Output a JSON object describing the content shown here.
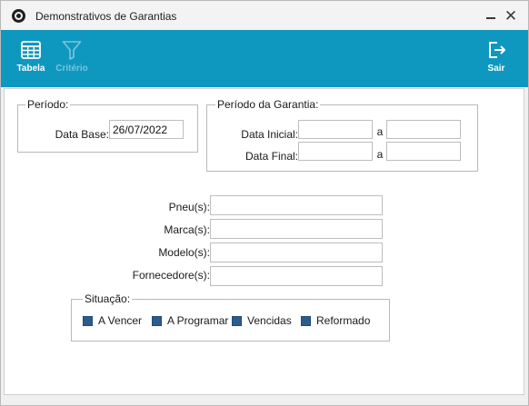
{
  "window": {
    "title": "Demonstrativos de Garantias",
    "icons": {
      "app": "app-logo-icon",
      "minimize": "minimize-icon",
      "close": "close-icon"
    },
    "close_glyph": "✕"
  },
  "toolbar": {
    "bg_color": "#0f98bf",
    "tabela": {
      "label": "Tabela",
      "icon": "table-grid-icon"
    },
    "criterio": {
      "label": "Critério",
      "icon": "filter-funnel-icon",
      "disabled": true
    },
    "sair": {
      "label": "Sair",
      "icon": "exit-door-icon"
    }
  },
  "periodo": {
    "legend": "Período:",
    "data_base_label": "Data Base:",
    "data_base_value": "26/07/2022"
  },
  "periodo_garantia": {
    "legend": "Período da Garantia:",
    "data_inicial_label": "Data Inicial:",
    "data_final_label": "Data Final:",
    "separator": "a",
    "data_inicial_value": "",
    "data_inicial_ate_value": "",
    "data_final_value": "",
    "data_final_ate_value": ""
  },
  "filters": {
    "pneus_label": "Pneu(s):",
    "marcas_label": "Marca(s):",
    "modelos_label": "Modelo(s):",
    "fornecedores_label": "Fornecedore(s):"
  },
  "situacao": {
    "legend": "Situação:",
    "options": [
      {
        "label": "A Vencer",
        "checked": true
      },
      {
        "label": "A Programar",
        "checked": true
      },
      {
        "label": "Vencidas",
        "checked": true
      },
      {
        "label": "Reformado",
        "checked": true
      }
    ],
    "check_color": "#2d5c8c"
  }
}
